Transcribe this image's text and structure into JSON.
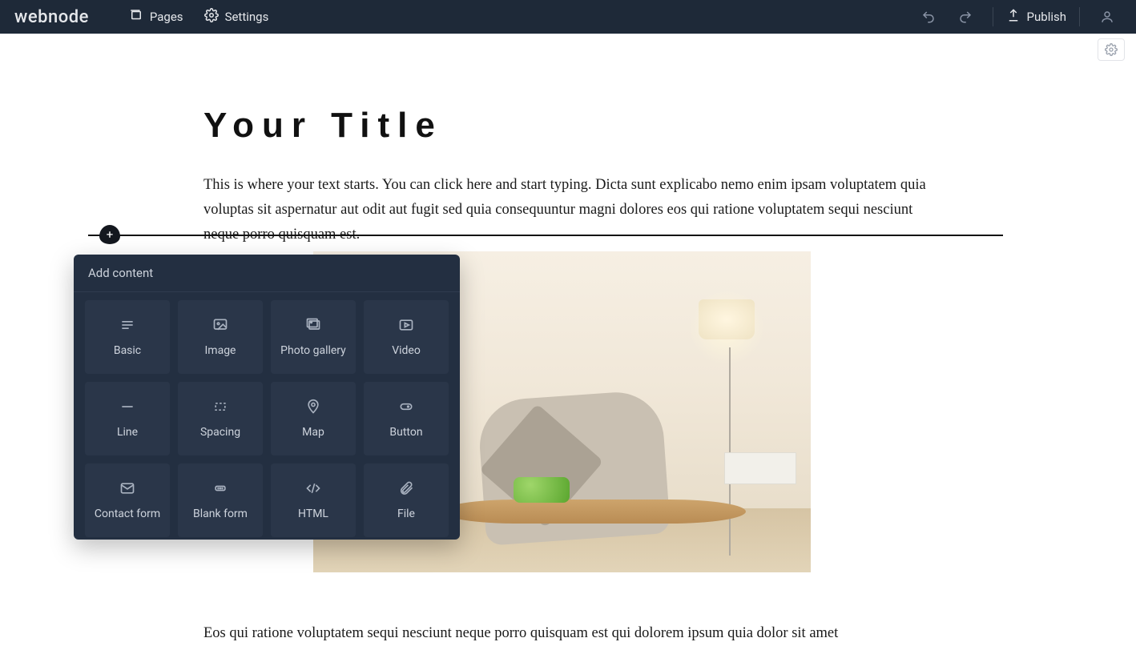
{
  "header": {
    "logo": "webnode",
    "pages": "Pages",
    "settings": "Settings",
    "publish": "Publish"
  },
  "page": {
    "title": "Your Title",
    "paragraph1": "This is where your text starts. You can click here and start typing. Dicta sunt explicabo nemo enim ipsam voluptatem quia voluptas sit aspernatur aut odit aut fugit sed quia consequuntur magni dolores eos qui ratione voluptatem sequi nesciunt neque porro quisquam est.",
    "paragraph2": "Eos qui ratione voluptatem sequi nesciunt neque porro quisquam est qui dolorem ipsum quia dolor sit amet"
  },
  "popup": {
    "title": "Add content",
    "items": [
      {
        "label": "Basic"
      },
      {
        "label": "Image"
      },
      {
        "label": "Photo gallery"
      },
      {
        "label": "Video"
      },
      {
        "label": "Line"
      },
      {
        "label": "Spacing"
      },
      {
        "label": "Map"
      },
      {
        "label": "Button"
      },
      {
        "label": "Contact form"
      },
      {
        "label": "Blank form"
      },
      {
        "label": "HTML"
      },
      {
        "label": "File"
      }
    ]
  }
}
